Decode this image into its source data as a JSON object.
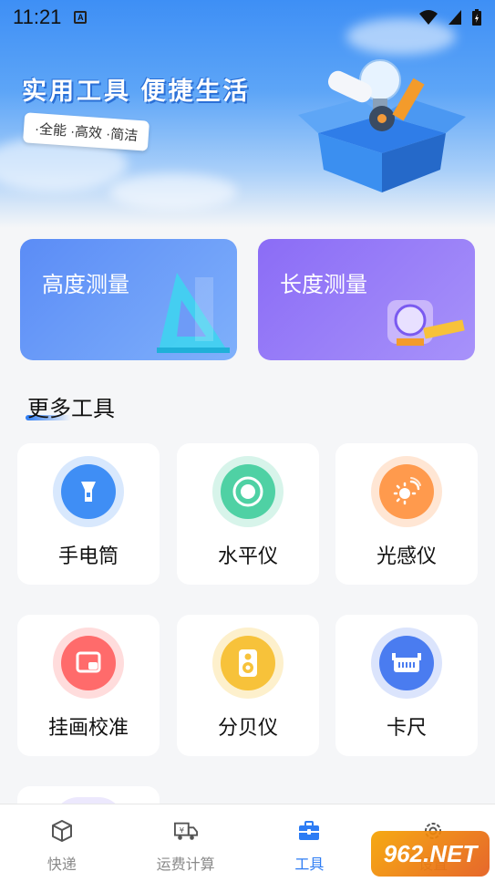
{
  "status_bar": {
    "time": "11:21",
    "notification_icon": "A"
  },
  "hero": {
    "title": "实用工具 便捷生活",
    "tagline": "·全能 ·高效 ·简洁"
  },
  "measure_cards": [
    {
      "label": "高度测量",
      "icon": "triangle-ruler-icon"
    },
    {
      "label": "长度测量",
      "icon": "tape-measure-icon"
    }
  ],
  "section": {
    "title": "更多工具"
  },
  "tools": [
    {
      "label": "手电筒",
      "icon": "flashlight-icon",
      "color": "#3f8ef5",
      "ring": "#d8e8fd"
    },
    {
      "label": "水平仪",
      "icon": "level-icon",
      "color": "#4fd1a4",
      "ring": "#d7f4ea"
    },
    {
      "label": "光感仪",
      "icon": "light-sensor-icon",
      "color": "#ff9a4d",
      "ring": "#ffe6d4"
    },
    {
      "label": "挂画校准",
      "icon": "picture-frame-icon",
      "color": "#ff6b6b",
      "ring": "#ffdcdc"
    },
    {
      "label": "分贝仪",
      "icon": "speaker-icon",
      "color": "#f7c23a",
      "ring": "#fdf0cc"
    },
    {
      "label": "卡尺",
      "icon": "caliper-icon",
      "color": "#4a7cf0",
      "ring": "#dbe4fc"
    }
  ],
  "bottom_nav": [
    {
      "label": "快递",
      "icon": "package-icon",
      "active": false
    },
    {
      "label": "运费计算",
      "icon": "truck-yen-icon",
      "active": false
    },
    {
      "label": "工具",
      "icon": "toolbox-icon",
      "active": true
    },
    {
      "label": "设置",
      "icon": "gear-icon",
      "active": false
    }
  ],
  "watermark": "962.NET",
  "colors": {
    "primary": "#2d7cf4",
    "background": "#f5f6f8"
  }
}
